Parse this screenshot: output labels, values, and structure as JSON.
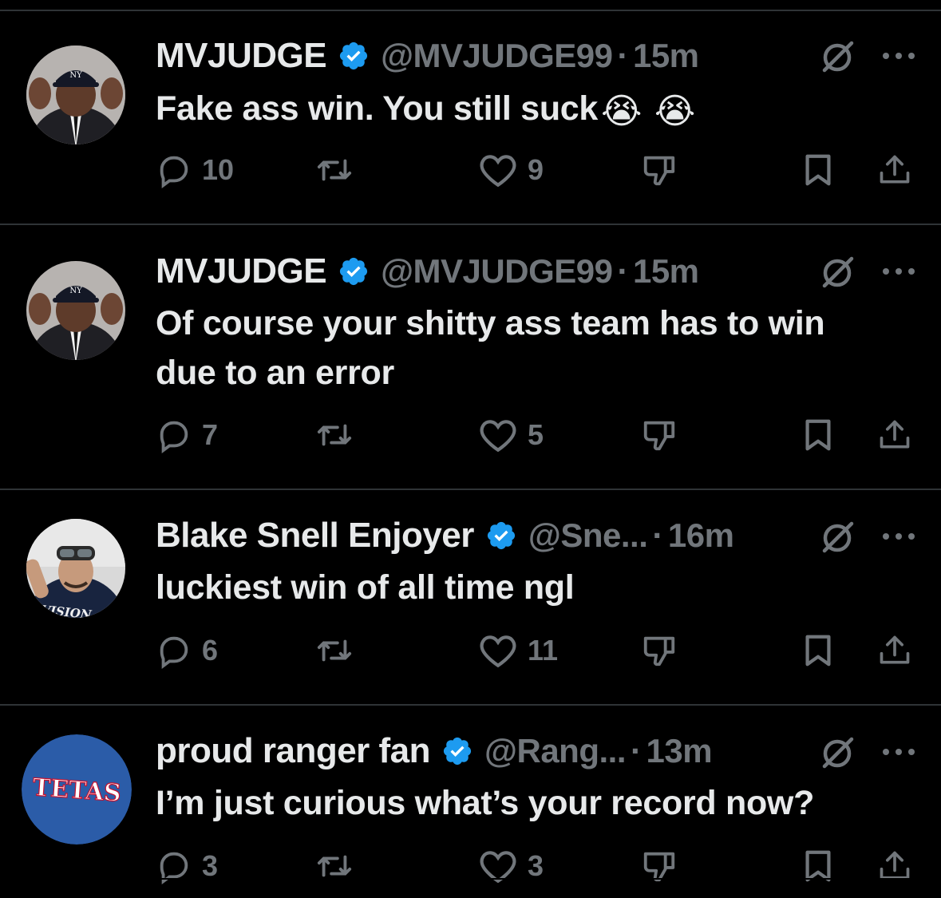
{
  "colors": {
    "background": "#000000",
    "text_primary": "#e7e9ea",
    "text_secondary": "#71767b",
    "divider": "#2f3336",
    "verified_blue": "#1d9bf0"
  },
  "icons": {
    "reply": "reply-icon",
    "retweet": "retweet-icon",
    "like": "heart-icon",
    "dislike": "thumbs-down-icon",
    "bookmark": "bookmark-icon",
    "share": "share-icon",
    "grok": "grok-icon",
    "more": "more-icon",
    "verified": "verified-badge-icon"
  },
  "tweets": [
    {
      "display_name": "MVJUDGE",
      "handle": "@MVJUDGE99",
      "separator": "·",
      "time": "15m",
      "text": "Fake ass win. You still suck",
      "emojis": [
        "😭",
        "😭"
      ],
      "replies": "10",
      "likes": "9"
    },
    {
      "display_name": "MVJUDGE",
      "handle": "@MVJUDGE99",
      "separator": "·",
      "time": "15m",
      "text_line1": "Of course your shitty ass team has to win",
      "text_line2": "due to an error",
      "replies": "7",
      "likes": "5"
    },
    {
      "display_name": "Blake Snell Enjoyer",
      "handle": "@Sne...",
      "separator": "·",
      "time": "16m",
      "text": "luckiest win of all time ngl",
      "avatar_text": "DIVISION",
      "replies": "6",
      "likes": "11"
    },
    {
      "display_name": "proud ranger fan",
      "handle": "@Rang...",
      "separator": "·",
      "time": "13m",
      "text": "I’m just curious what’s your record now?",
      "avatar_text": "TETAS",
      "replies": "3",
      "likes": "3"
    }
  ]
}
